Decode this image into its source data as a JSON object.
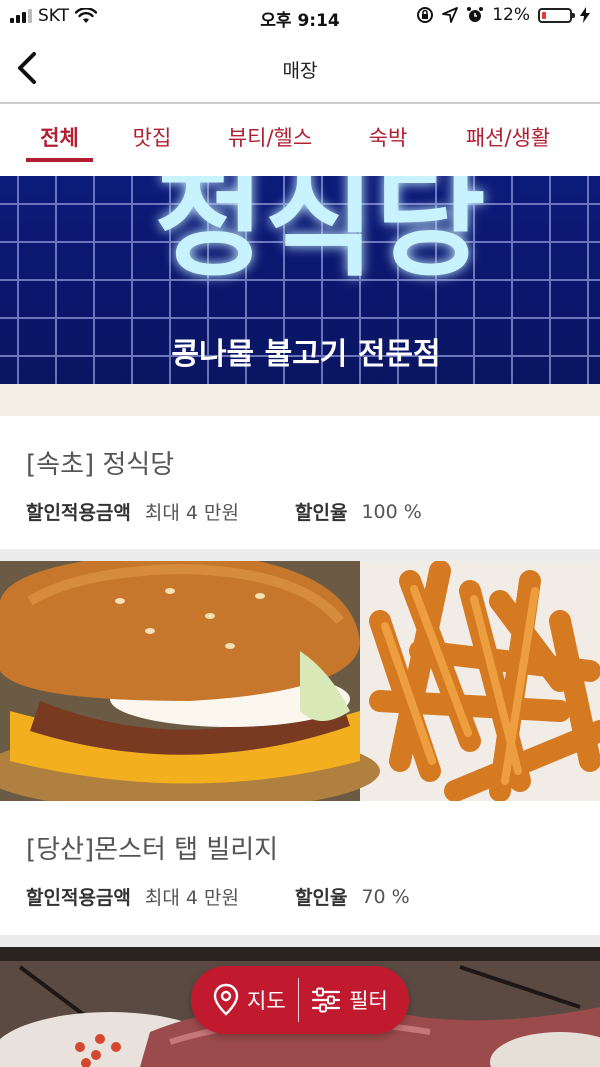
{
  "status_bar": {
    "carrier": "SKT",
    "time": "오후 9:14",
    "battery_percent": "12%",
    "icons": [
      "signal-icon",
      "wifi-icon",
      "screen-lock-icon",
      "location-icon",
      "alarm-icon",
      "battery-icon",
      "charging-icon"
    ]
  },
  "header": {
    "title": "매장",
    "back_icon": "chevron-left-icon"
  },
  "tabs": [
    {
      "label": "전체",
      "active": true
    },
    {
      "label": "맛집",
      "active": false
    },
    {
      "label": "뷰티/헬스",
      "active": false
    },
    {
      "label": "숙박",
      "active": false
    },
    {
      "label": "패션/생활",
      "active": false
    }
  ],
  "stores": [
    {
      "name": "[속초] 정식당",
      "discount_amount_label": "할인적용금액",
      "discount_amount_value": "최대 4 만원",
      "discount_rate_label": "할인율",
      "discount_rate_value": "100 %",
      "photo_sign_text": "정식당",
      "photo_subtitle": "콩나물 불고기 전문점"
    },
    {
      "name": "[당산]몬스터 탭 빌리지",
      "discount_amount_label": "할인적용금액",
      "discount_amount_value": "최대 4 만원",
      "discount_rate_label": "할인율",
      "discount_rate_value": "70 %"
    }
  ],
  "fab": {
    "map_label": "지도",
    "filter_label": "필터",
    "map_icon": "map-pin-icon",
    "filter_icon": "sliders-icon"
  },
  "colors": {
    "accent": "#b01f32",
    "fab_bg": "#c11a2f",
    "divider": "#ececec"
  }
}
